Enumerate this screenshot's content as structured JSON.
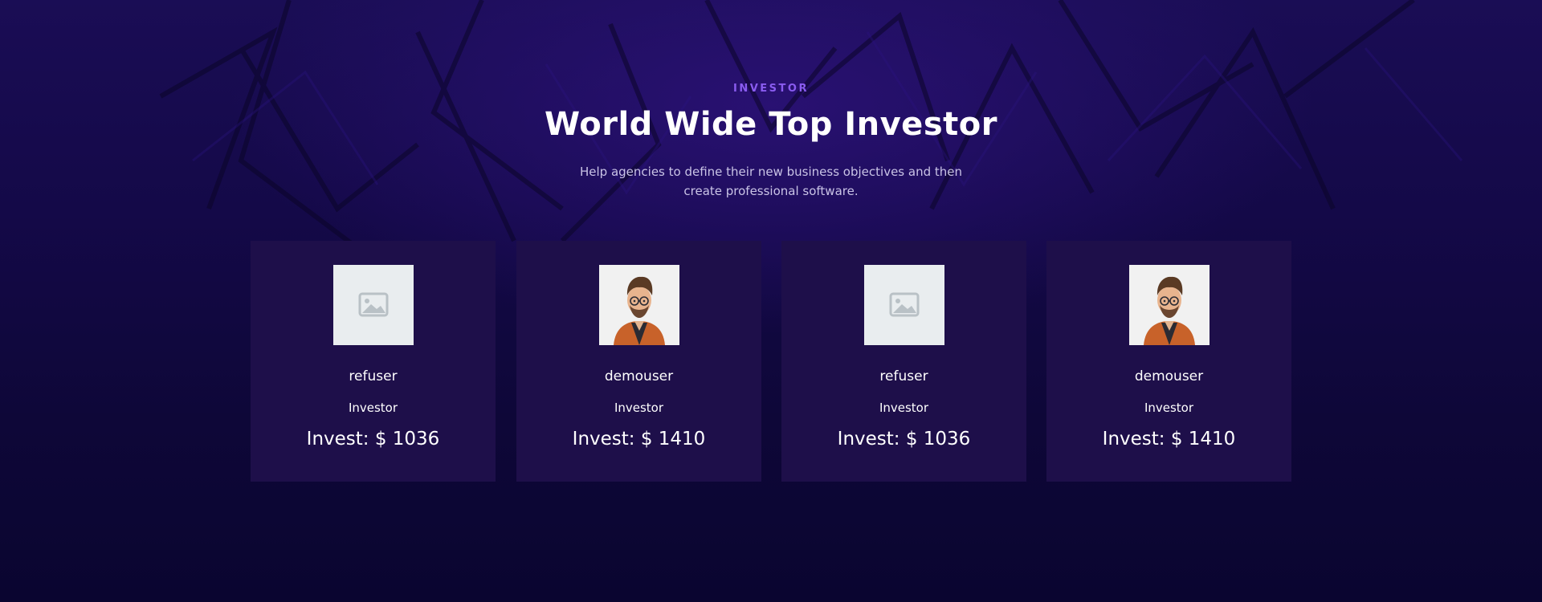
{
  "section": {
    "eyebrow": "INVESTOR",
    "title": "World Wide Top Investor",
    "subtitle": "Help agencies to define their new business objectives and then create professional software."
  },
  "investors": [
    {
      "name": "refuser",
      "role": "Investor",
      "invest": "Invest: $ 1036",
      "avatar": "placeholder-image-icon"
    },
    {
      "name": "demouser",
      "role": "Investor",
      "invest": "Invest: $ 1410",
      "avatar": "cartoon-man-avatar"
    },
    {
      "name": "refuser",
      "role": "Investor",
      "invest": "Invest: $ 1036",
      "avatar": "placeholder-image-icon"
    },
    {
      "name": "demouser",
      "role": "Investor",
      "invest": "Invest: $ 1410",
      "avatar": "cartoon-man-avatar"
    }
  ],
  "colors": {
    "background": "#0c0630",
    "card": "#1e0f4a",
    "accent": "#8a5cf0",
    "text": "#ffffff",
    "muted_text": "#c9c3e6"
  }
}
